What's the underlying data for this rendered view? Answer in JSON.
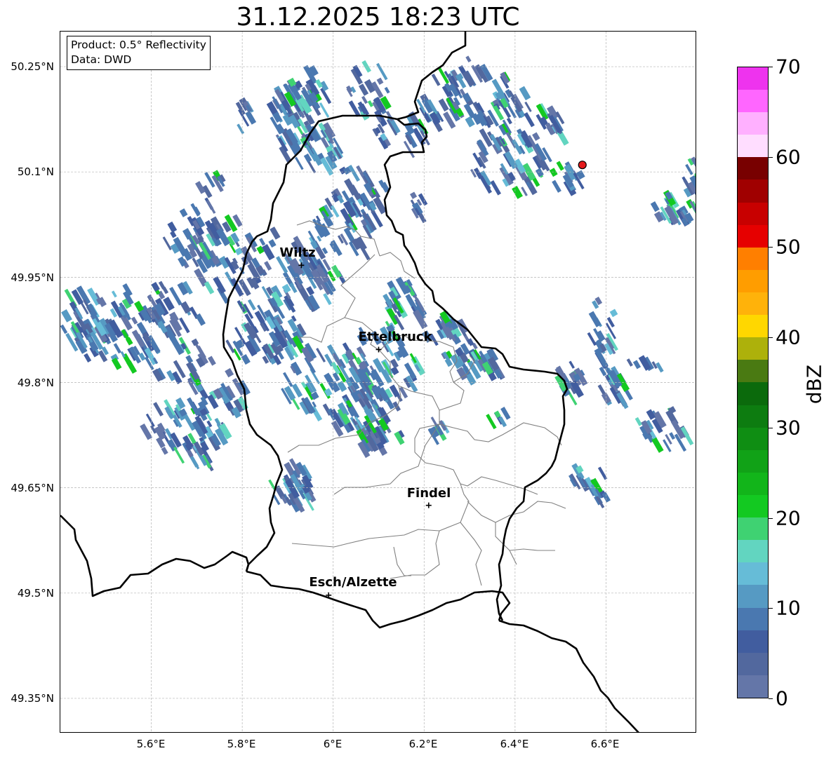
{
  "title": "31.12.2025 18:23 UTC",
  "info": {
    "product": "Product: 0.5° Reflectivity",
    "data": "Data: DWD"
  },
  "axes": {
    "lat_labels": [
      "50.25°N",
      "50.1°N",
      "49.95°N",
      "49.8°N",
      "49.65°N",
      "49.5°N",
      "49.35°N"
    ],
    "lat_values": [
      50.25,
      50.1,
      49.95,
      49.8,
      49.65,
      49.5,
      49.35
    ],
    "lon_labels": [
      "5.6°E",
      "5.8°E",
      "6°E",
      "6.2°E",
      "6.4°E",
      "6.6°E"
    ],
    "lon_values": [
      5.6,
      5.8,
      6.0,
      6.2,
      6.4,
      6.6
    ],
    "lon_range": [
      5.4,
      6.8
    ],
    "lat_range": [
      49.3,
      50.3
    ],
    "grid": true
  },
  "cities": [
    {
      "name": "Wiltz",
      "lon": 5.93,
      "lat": 49.967
    },
    {
      "name": "Ettelbruck",
      "lon": 6.1,
      "lat": 49.847
    },
    {
      "name": "Findel",
      "lon": 6.21,
      "lat": 49.625
    },
    {
      "name": "Esch/Alzette",
      "lon": 5.99,
      "lat": 49.497
    }
  ],
  "radar_site": {
    "lon": 6.548,
    "lat": 50.11,
    "color": "#e41a1c"
  },
  "colorbar": {
    "label": "dBZ",
    "ticks": [
      "0",
      "10",
      "20",
      "30",
      "40",
      "50",
      "60",
      "70"
    ],
    "tick_values": [
      0,
      10,
      20,
      30,
      40,
      50,
      60,
      70
    ],
    "min": 0,
    "max": 70,
    "colors": [
      "#6476a8",
      "#52689e",
      "#415d9f",
      "#4a78b0",
      "#569ac3",
      "#66bcd7",
      "#62d5c0",
      "#3fd272",
      "#13c921",
      "#12b51a",
      "#11a217",
      "#0f8e13",
      "#0d7c10",
      "#0b6a0c",
      "#4a7a12",
      "#adb10b",
      "#ffd700",
      "#ffb20a",
      "#ff9d00",
      "#ff7f00",
      "#e60000",
      "#c80000",
      "#a00000",
      "#780000",
      "#ffddff",
      "#ffb0ff",
      "#ff66ff",
      "#ee33ee"
    ]
  },
  "colors": {
    "border_national": "#000000",
    "border_cantonal": "#808080",
    "grid": "#b4b4b4"
  }
}
